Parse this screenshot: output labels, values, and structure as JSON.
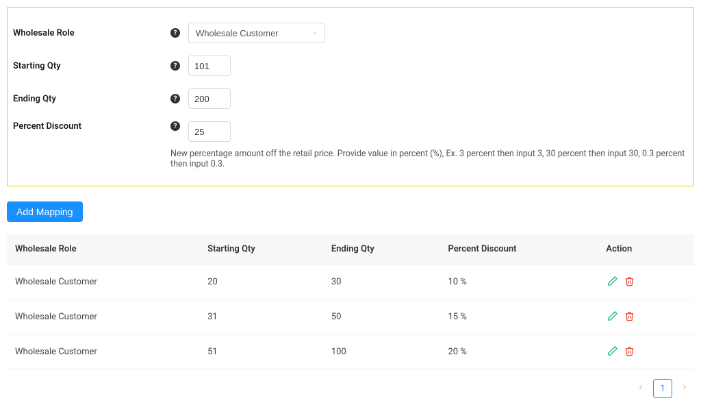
{
  "form": {
    "wholesaleRole": {
      "label": "Wholesale Role",
      "value": "Wholesale Customer"
    },
    "startingQty": {
      "label": "Starting Qty",
      "value": "101"
    },
    "endingQty": {
      "label": "Ending Qty",
      "value": "200"
    },
    "percentDiscount": {
      "label": "Percent Discount",
      "value": "25",
      "helper": "New percentage amount off the retail price. Provide value in percent (%), Ex. 3 percent then input 3, 30 percent then input 30, 0.3 percent then input 0.3."
    }
  },
  "addMappingLabel": "Add Mapping",
  "table": {
    "headers": {
      "role": "Wholesale Role",
      "startingQty": "Starting Qty",
      "endingQty": "Ending Qty",
      "percentDiscount": "Percent Discount",
      "action": "Action"
    },
    "rows": [
      {
        "role": "Wholesale Customer",
        "startingQty": "20",
        "endingQty": "30",
        "percentDiscount": "10 %"
      },
      {
        "role": "Wholesale Customer",
        "startingQty": "31",
        "endingQty": "50",
        "percentDiscount": "15 %"
      },
      {
        "role": "Wholesale Customer",
        "startingQty": "51",
        "endingQty": "100",
        "percentDiscount": "20 %"
      }
    ]
  },
  "pagination": {
    "current": "1"
  }
}
